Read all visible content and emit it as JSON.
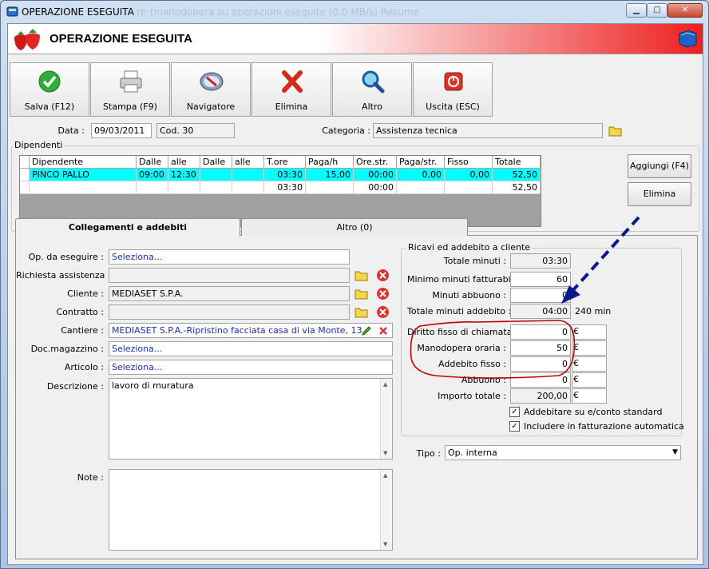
{
  "window": {
    "title": "OPERAZIONE ESEGUITA",
    "ghost_title": "rp:(manodopera su operazioni eseguite (0.0 MB/s) Resume",
    "min_icon": "minimize-icon",
    "max_icon": "maximize-icon",
    "close_icon": "close-icon",
    "min_glyph": "▁",
    "max_glyph": "□",
    "close_glyph": "✕"
  },
  "header": {
    "title": "OPERAZIONE ESEGUITA",
    "left_icon": "strawberries-icon",
    "right_icon": "book-icon"
  },
  "toolbar": [
    {
      "label": "Salva (F12)",
      "icon": "check-icon"
    },
    {
      "label": "Stampa (F9)",
      "icon": "printer-icon"
    },
    {
      "label": "Navigatore",
      "icon": "compass-icon"
    },
    {
      "label": "Elimina",
      "icon": "red-x-icon"
    },
    {
      "label": "Altro",
      "icon": "search-icon"
    },
    {
      "label": "Uscita (ESC)",
      "icon": "power-icon"
    }
  ],
  "form": {
    "data_label": "Data :",
    "data_value": "09/03/2011",
    "cod_value": "Cod. 30",
    "categoria_label": "Categoria :",
    "categoria_value": "Assistenza tecnica"
  },
  "dipendenti": {
    "label": "Dipendenti",
    "columns": [
      "Dipendente",
      "Dalle",
      "alle",
      "Dalle",
      "alle",
      "T.ore",
      "Paga/h",
      "Ore.str.",
      "Paga/str.",
      "Fisso",
      "Totale"
    ],
    "rows": [
      [
        "PINCO PALLO",
        "09:00",
        "12:30",
        "",
        "",
        "03:30",
        "15,00",
        "00:00",
        "0,00",
        "0,00",
        "52,50"
      ],
      [
        "",
        "",
        "",
        "",
        "",
        "03:30",
        "",
        "00:00",
        "",
        "",
        "52,50"
      ]
    ],
    "add_button": "Aggiungi (F4)",
    "delete_button": "Elimina"
  },
  "tabs": [
    {
      "label": "Collegamenti e addebiti",
      "active": true
    },
    {
      "label": "Altro (0)",
      "active": false
    }
  ],
  "left": {
    "op_label": "Op. da eseguire :",
    "op_value": "Seleziona...",
    "richiesta_label": "Richiesta assistenza :",
    "richiesta_value": "",
    "cliente_label": "Cliente :",
    "cliente_value": "MEDIASET S.P.A.",
    "contratto_label": "Contratto :",
    "contratto_value": "",
    "cantiere_label": "Cantiere :",
    "cantiere_value": "MEDIASET S.P.A.-Ripristino facciata casa di via Monte, 13",
    "doc_label": "Doc.magazzino :",
    "doc_value": "Seleziona...",
    "articolo_label": "Articolo :",
    "articolo_value": "Seleziona...",
    "descrizione_label": "Descrizione :",
    "descrizione_value": "lavoro di muratura",
    "note_label": "Note :",
    "note_value": ""
  },
  "ricavi": {
    "title": "Ricavi ed addebito a cliente",
    "totale_minuti_label": "Totale minuti :",
    "totale_minuti": "03:30",
    "minimo_label": "Minimo minuti fatturabili :",
    "minimo": "60",
    "abbuono_min_label": "Minuti abbuono :",
    "abbuono_min": "0",
    "tot_addebito_label": "Totale minuti addebito :",
    "tot_addebito": "04:00",
    "tot_addebito_min": "240 min",
    "diritto_label": "Diritto fisso di chiamata :",
    "diritto": "0",
    "manodopera_label": "Manodopera oraria :",
    "manodopera": "50",
    "addebito_fisso_label": "Addebito fisso :",
    "addebito_fisso": "0",
    "abbuono_label": "Abbuono :",
    "abbuono": "0",
    "importo_label": "Importo totale :",
    "importo": "200,00",
    "euro": "€",
    "chk1_label": "Addebitare su e/conto standard",
    "chk1": true,
    "chk2_label": "Includere in fatturazione automatica",
    "chk2": true
  },
  "tipo": {
    "label": "Tipo :",
    "value": "Op. interna"
  },
  "colors": {
    "selection": "#00ffff",
    "annotation_circle": "#c00000",
    "annotation_arrow": "#0a1a8c",
    "header_red": "#ee2020"
  }
}
